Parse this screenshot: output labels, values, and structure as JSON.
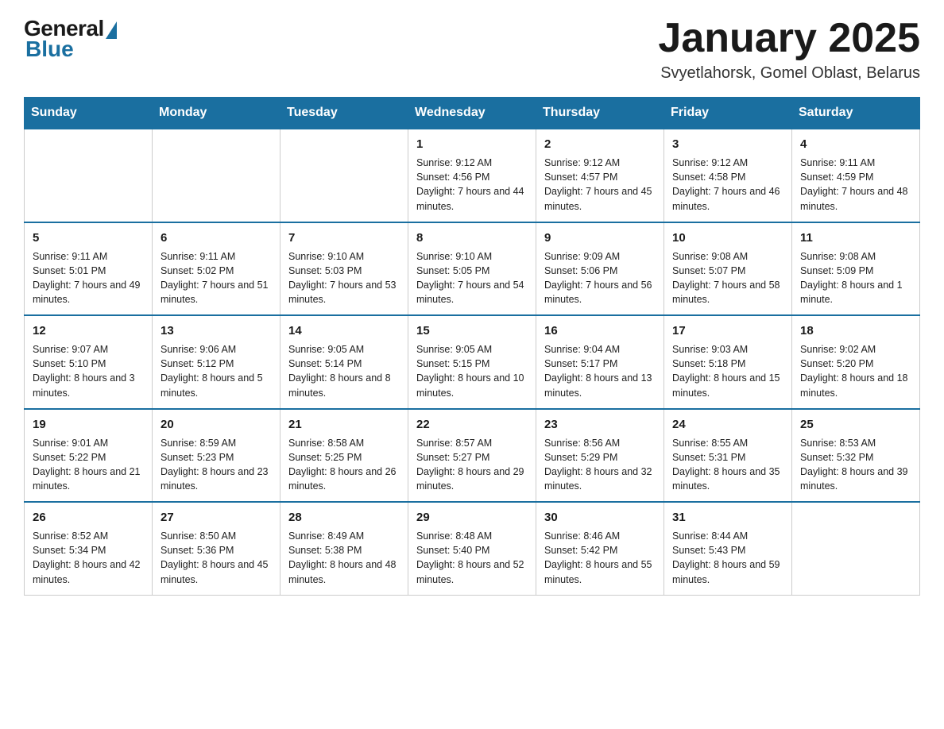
{
  "header": {
    "logo": {
      "general": "General",
      "blue": "Blue"
    },
    "title": "January 2025",
    "location": "Svyetlahorsk, Gomel Oblast, Belarus"
  },
  "weekdays": [
    "Sunday",
    "Monday",
    "Tuesday",
    "Wednesday",
    "Thursday",
    "Friday",
    "Saturday"
  ],
  "weeks": [
    [
      {
        "day": "",
        "info": ""
      },
      {
        "day": "",
        "info": ""
      },
      {
        "day": "",
        "info": ""
      },
      {
        "day": "1",
        "info": "Sunrise: 9:12 AM\nSunset: 4:56 PM\nDaylight: 7 hours\nand 44 minutes."
      },
      {
        "day": "2",
        "info": "Sunrise: 9:12 AM\nSunset: 4:57 PM\nDaylight: 7 hours\nand 45 minutes."
      },
      {
        "day": "3",
        "info": "Sunrise: 9:12 AM\nSunset: 4:58 PM\nDaylight: 7 hours\nand 46 minutes."
      },
      {
        "day": "4",
        "info": "Sunrise: 9:11 AM\nSunset: 4:59 PM\nDaylight: 7 hours\nand 48 minutes."
      }
    ],
    [
      {
        "day": "5",
        "info": "Sunrise: 9:11 AM\nSunset: 5:01 PM\nDaylight: 7 hours\nand 49 minutes."
      },
      {
        "day": "6",
        "info": "Sunrise: 9:11 AM\nSunset: 5:02 PM\nDaylight: 7 hours\nand 51 minutes."
      },
      {
        "day": "7",
        "info": "Sunrise: 9:10 AM\nSunset: 5:03 PM\nDaylight: 7 hours\nand 53 minutes."
      },
      {
        "day": "8",
        "info": "Sunrise: 9:10 AM\nSunset: 5:05 PM\nDaylight: 7 hours\nand 54 minutes."
      },
      {
        "day": "9",
        "info": "Sunrise: 9:09 AM\nSunset: 5:06 PM\nDaylight: 7 hours\nand 56 minutes."
      },
      {
        "day": "10",
        "info": "Sunrise: 9:08 AM\nSunset: 5:07 PM\nDaylight: 7 hours\nand 58 minutes."
      },
      {
        "day": "11",
        "info": "Sunrise: 9:08 AM\nSunset: 5:09 PM\nDaylight: 8 hours\nand 1 minute."
      }
    ],
    [
      {
        "day": "12",
        "info": "Sunrise: 9:07 AM\nSunset: 5:10 PM\nDaylight: 8 hours\nand 3 minutes."
      },
      {
        "day": "13",
        "info": "Sunrise: 9:06 AM\nSunset: 5:12 PM\nDaylight: 8 hours\nand 5 minutes."
      },
      {
        "day": "14",
        "info": "Sunrise: 9:05 AM\nSunset: 5:14 PM\nDaylight: 8 hours\nand 8 minutes."
      },
      {
        "day": "15",
        "info": "Sunrise: 9:05 AM\nSunset: 5:15 PM\nDaylight: 8 hours\nand 10 minutes."
      },
      {
        "day": "16",
        "info": "Sunrise: 9:04 AM\nSunset: 5:17 PM\nDaylight: 8 hours\nand 13 minutes."
      },
      {
        "day": "17",
        "info": "Sunrise: 9:03 AM\nSunset: 5:18 PM\nDaylight: 8 hours\nand 15 minutes."
      },
      {
        "day": "18",
        "info": "Sunrise: 9:02 AM\nSunset: 5:20 PM\nDaylight: 8 hours\nand 18 minutes."
      }
    ],
    [
      {
        "day": "19",
        "info": "Sunrise: 9:01 AM\nSunset: 5:22 PM\nDaylight: 8 hours\nand 21 minutes."
      },
      {
        "day": "20",
        "info": "Sunrise: 8:59 AM\nSunset: 5:23 PM\nDaylight: 8 hours\nand 23 minutes."
      },
      {
        "day": "21",
        "info": "Sunrise: 8:58 AM\nSunset: 5:25 PM\nDaylight: 8 hours\nand 26 minutes."
      },
      {
        "day": "22",
        "info": "Sunrise: 8:57 AM\nSunset: 5:27 PM\nDaylight: 8 hours\nand 29 minutes."
      },
      {
        "day": "23",
        "info": "Sunrise: 8:56 AM\nSunset: 5:29 PM\nDaylight: 8 hours\nand 32 minutes."
      },
      {
        "day": "24",
        "info": "Sunrise: 8:55 AM\nSunset: 5:31 PM\nDaylight: 8 hours\nand 35 minutes."
      },
      {
        "day": "25",
        "info": "Sunrise: 8:53 AM\nSunset: 5:32 PM\nDaylight: 8 hours\nand 39 minutes."
      }
    ],
    [
      {
        "day": "26",
        "info": "Sunrise: 8:52 AM\nSunset: 5:34 PM\nDaylight: 8 hours\nand 42 minutes."
      },
      {
        "day": "27",
        "info": "Sunrise: 8:50 AM\nSunset: 5:36 PM\nDaylight: 8 hours\nand 45 minutes."
      },
      {
        "day": "28",
        "info": "Sunrise: 8:49 AM\nSunset: 5:38 PM\nDaylight: 8 hours\nand 48 minutes."
      },
      {
        "day": "29",
        "info": "Sunrise: 8:48 AM\nSunset: 5:40 PM\nDaylight: 8 hours\nand 52 minutes."
      },
      {
        "day": "30",
        "info": "Sunrise: 8:46 AM\nSunset: 5:42 PM\nDaylight: 8 hours\nand 55 minutes."
      },
      {
        "day": "31",
        "info": "Sunrise: 8:44 AM\nSunset: 5:43 PM\nDaylight: 8 hours\nand 59 minutes."
      },
      {
        "day": "",
        "info": ""
      }
    ]
  ]
}
